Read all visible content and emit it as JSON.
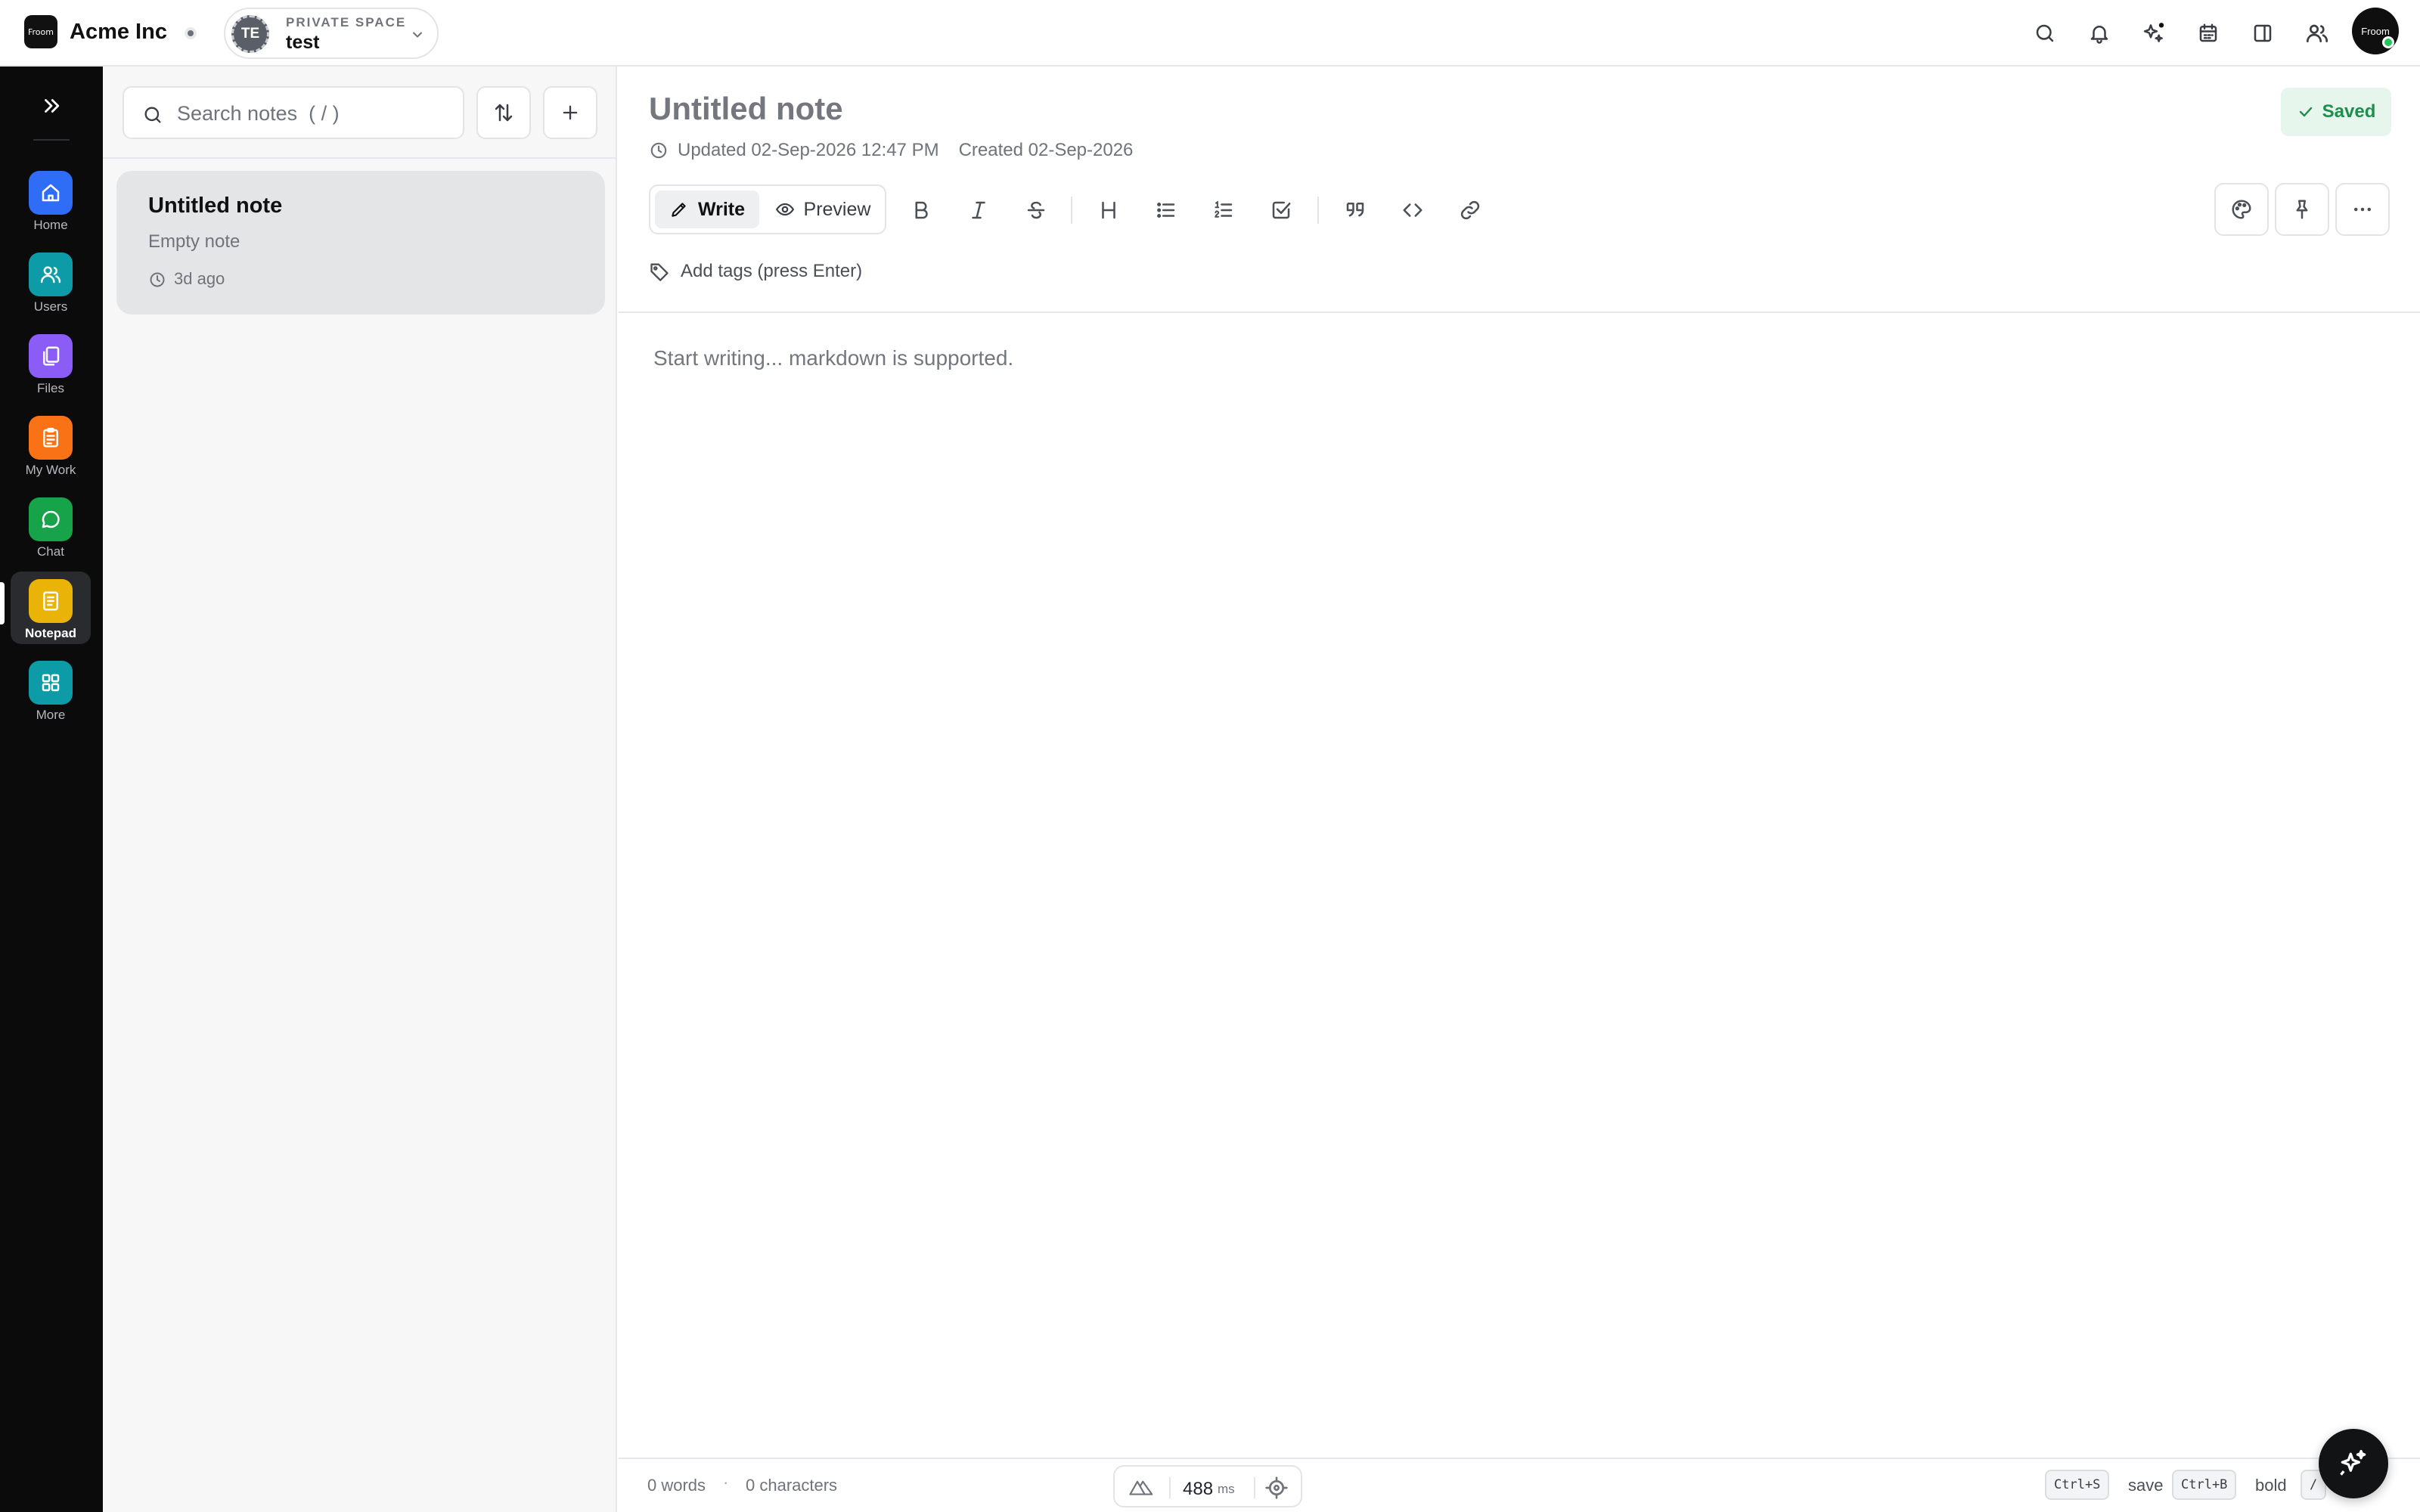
{
  "brand": {
    "logo_text": "Froom",
    "name": "Acme Inc"
  },
  "space": {
    "kicker": "PRIVATE SPACE",
    "name": "test",
    "initials": "TE"
  },
  "user": {
    "avatar_text": "Froom"
  },
  "rail": {
    "items": [
      {
        "label": "Home",
        "icon": "home-icon",
        "color": "#2f6df6"
      },
      {
        "label": "Users",
        "icon": "users-icon",
        "color": "#0e9ba8"
      },
      {
        "label": "Files",
        "icon": "files-icon",
        "color": "#8b5cf6"
      },
      {
        "label": "My Work",
        "icon": "clipboard-icon",
        "color": "#f97316"
      },
      {
        "label": "Chat",
        "icon": "chat-icon",
        "color": "#16a34a"
      },
      {
        "label": "Notepad",
        "icon": "notepad-icon",
        "color": "#eab308"
      },
      {
        "label": "More",
        "icon": "grid-icon",
        "color": "#0e9ba8"
      }
    ],
    "active": "Notepad"
  },
  "notes": {
    "search_placeholder": "Search notes  ( / )",
    "items": [
      {
        "title": "Untitled note",
        "preview": "Empty note",
        "time": "3d ago"
      }
    ]
  },
  "editor": {
    "title": "Untitled note",
    "updated": "Updated 02-Sep-2026 12:47 PM",
    "created": "Created 02-Sep-2026",
    "saved_label": "Saved",
    "write_label": "Write",
    "preview_label": "Preview",
    "tags_placeholder": "Add tags (press Enter)",
    "body_placeholder": "Start writing... markdown is supported."
  },
  "footer": {
    "words": "0 words",
    "separator": "·",
    "characters": "0 characters",
    "latency_value": "488",
    "latency_unit": "ms",
    "shortcuts": [
      {
        "key": "Ctrl+S",
        "label": "save"
      },
      {
        "key": "Ctrl+B",
        "label": "bold"
      },
      {
        "key": "/",
        "label": ""
      }
    ]
  },
  "colors": {
    "accent": "#1e8e4c",
    "rail_bg": "#0b0b0c"
  }
}
